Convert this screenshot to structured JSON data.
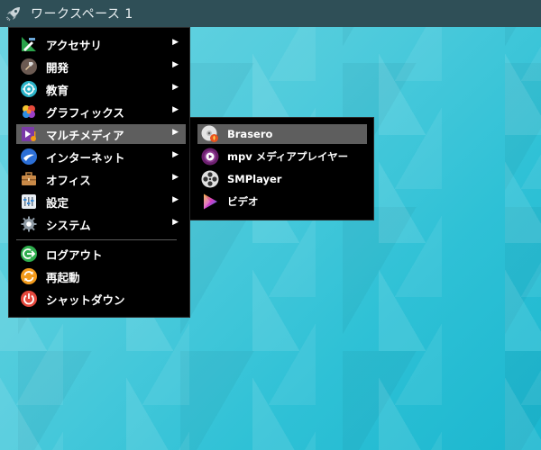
{
  "topbar": {
    "workspace_label": "ワークスペース 1",
    "launcher_icon": "rocket-icon"
  },
  "main_menu": {
    "items": [
      {
        "label": "アクセサリ",
        "icon": "accessories-icon",
        "has_submenu": true
      },
      {
        "label": "開発",
        "icon": "development-hammer-icon",
        "has_submenu": true
      },
      {
        "label": "教育",
        "icon": "education-icon",
        "has_submenu": true
      },
      {
        "label": "グラフィックス",
        "icon": "graphics-icon",
        "has_submenu": true
      },
      {
        "label": "マルチメディア",
        "icon": "multimedia-icon",
        "has_submenu": true,
        "highlighted": true
      },
      {
        "label": "インターネット",
        "icon": "internet-icon",
        "has_submenu": true
      },
      {
        "label": "オフィス",
        "icon": "office-briefcase-icon",
        "has_submenu": true
      },
      {
        "label": "設定",
        "icon": "settings-icon",
        "has_submenu": true
      },
      {
        "label": "システム",
        "icon": "system-gear-icon",
        "has_submenu": true
      }
    ],
    "session_items": [
      {
        "label": "ログアウト",
        "icon": "logout-icon"
      },
      {
        "label": "再起動",
        "icon": "reboot-icon"
      },
      {
        "label": "シャットダウン",
        "icon": "shutdown-icon"
      }
    ],
    "arrow_glyph": "▶"
  },
  "submenu": {
    "items": [
      {
        "label": "Brasero",
        "icon": "brasero-disc-icon",
        "highlighted": true
      },
      {
        "label": "mpv メディアプレイヤー",
        "icon": "mpv-icon"
      },
      {
        "label": "SMPlayer",
        "icon": "smplayer-film-reel-icon"
      },
      {
        "label": "ビデオ",
        "icon": "video-play-icon"
      }
    ]
  },
  "colors": {
    "topbar": "#2f4f57",
    "menu_bg": "#000000",
    "highlight": "#5e5e5e",
    "desktop": "#3cc6da"
  }
}
